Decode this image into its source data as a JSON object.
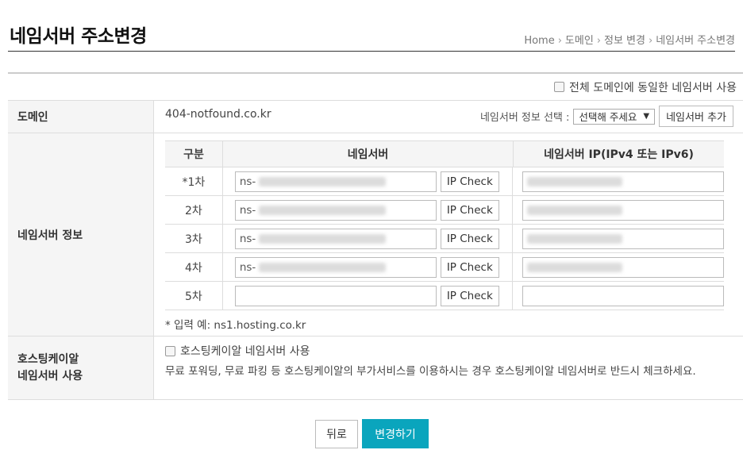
{
  "page": {
    "title": "네임서버 주소변경",
    "breadcrumb": [
      "Home",
      "도메인",
      "정보 변경",
      "네임서버 주소변경"
    ]
  },
  "apply_all": {
    "label": "전체 도메인에 동일한 네임서버 사용",
    "checked": false
  },
  "domain_row": {
    "label": "도메인",
    "value": "404-notfound.co.kr",
    "ns_info_select_label": "네임서버 정보 선택 :",
    "select_value": "선택해 주세요",
    "add_ns_button": "네임서버 추가"
  },
  "ns_info": {
    "label": "네임서버 정보",
    "columns": [
      "구분",
      "네임서버",
      "네임서버 IP(IPv4 또는 IPv6)"
    ],
    "rows": [
      {
        "order": "*1차",
        "ns_prefix": "ns-",
        "ip_check": "IP Check",
        "blurred": true
      },
      {
        "order": "2차",
        "ns_prefix": "ns-",
        "ip_check": "IP Check",
        "blurred": true
      },
      {
        "order": "3차",
        "ns_prefix": "ns-",
        "ip_check": "IP Check",
        "blurred": true
      },
      {
        "order": "4차",
        "ns_prefix": "ns-",
        "ip_check": "IP Check",
        "blurred": true
      },
      {
        "order": "5차",
        "ns_prefix": "",
        "ip_check": "IP Check",
        "blurred": false
      }
    ],
    "example_note": "* 입력 예: ns1.hosting.co.kr"
  },
  "hosting": {
    "label_line1": "호스팅케이알",
    "label_line2": "네임서버 사용",
    "checkbox_label": "호스팅케이알 네임서버 사용",
    "checked": false,
    "description": "무료 포워딩, 무료 파킹 등 호스팅케이알의 부가서비스를 이용하시는 경우 호스팅케이알 네임서버로 반드시 체크하세요."
  },
  "actions": {
    "back": "뒤로",
    "submit": "변경하기"
  },
  "colors": {
    "accent": "#0aa5bd",
    "header_bg": "#f5f5f5"
  },
  "icons": {
    "select_arrow": "triangle-down-icon",
    "breadcrumb_sep": "chevron-right-icon"
  }
}
